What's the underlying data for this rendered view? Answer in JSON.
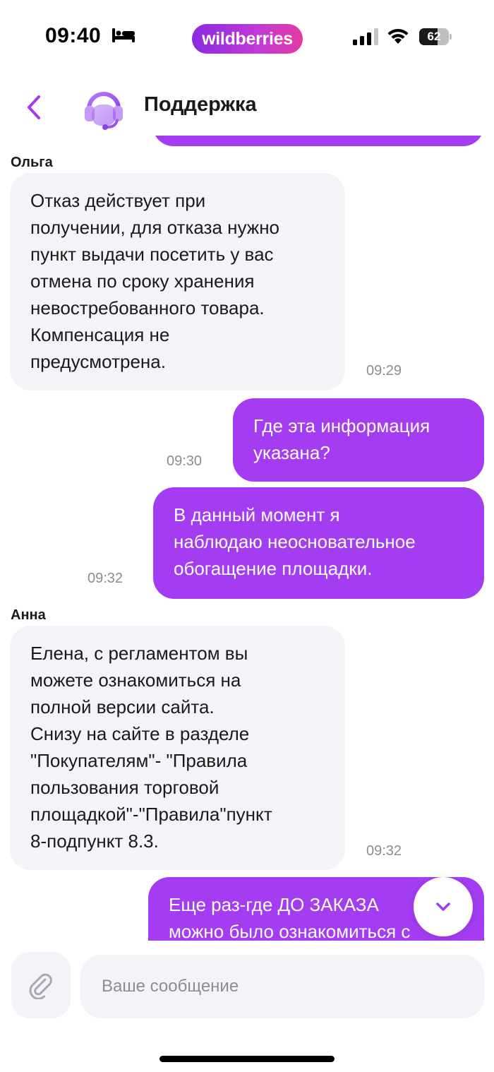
{
  "status_bar": {
    "time": "09:40",
    "brand": "wildberries",
    "battery_level": "62",
    "battery_fraction": 0.62
  },
  "header": {
    "title": "Поддержка",
    "back_icon": "chevron-left-icon",
    "avatar_icon": "headset-icon"
  },
  "messages": [
    {
      "sender": "Ольга",
      "direction": "incoming",
      "text": "Отказ действует при\nполучении, для отказа нужно\nпункт выдачи посетить у вас\nотмена по сроку хранения\nневостребованного товара.\nКомпенсация не\nпредусмотрена.",
      "time": "09:29"
    },
    {
      "direction": "outgoing",
      "text": "Где эта информация\nуказана?",
      "time": "09:30"
    },
    {
      "direction": "outgoing",
      "text": "В данный момент я\nнаблюдаю неосновательное\nобогащение площадки.",
      "time": "09:32"
    },
    {
      "sender": "Анна",
      "direction": "incoming",
      "text": "Елена, с регламентом вы\nможете ознакомиться на\nполной версии сайта.\nСнизу на сайте в разделе\n\"Покупателям\"- \"Правила\nпользования торговой\nплощадкой\"-\"Правила\"пункт\n8-подпункт 8.3.",
      "time": "09:32"
    },
    {
      "direction": "outgoing",
      "text": "Еще раз-где ДО ЗАКАЗА\nможно было ознакомиться с"
    }
  ],
  "input": {
    "placeholder": "Ваше сообщение",
    "attach_icon": "paperclip-icon",
    "scroll_icon": "chevron-down-icon"
  },
  "colors": {
    "accent": "#a43df2",
    "incoming_bubble": "#f4f3f8",
    "time_text": "#8c8c96"
  }
}
